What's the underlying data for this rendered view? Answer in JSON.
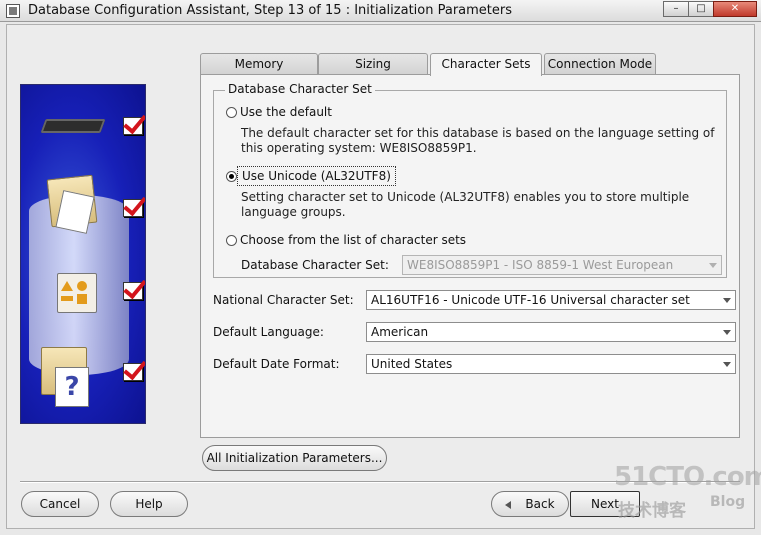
{
  "window": {
    "title": "Database Configuration Assistant, Step 13 of 15 : Initialization Parameters",
    "controls": [
      "–",
      "□",
      "✕"
    ]
  },
  "tabs": [
    {
      "label": "Memory",
      "active": false
    },
    {
      "label": "Sizing",
      "active": false
    },
    {
      "label": "Character Sets",
      "active": true
    },
    {
      "label": "Connection Mode",
      "active": false
    }
  ],
  "charset_group": {
    "legend": "Database Character Set",
    "use_default": {
      "label": "Use the default",
      "selected": false,
      "description": "The default character set for this database is based on the language setting of this operating system: WE8ISO8859P1."
    },
    "use_unicode": {
      "label": "Use Unicode (AL32UTF8)",
      "selected": true,
      "description": "Setting character set to Unicode (AL32UTF8) enables you to store multiple language groups."
    },
    "choose_list": {
      "label": "Choose from the list of character sets",
      "selected": false
    },
    "db_charset_label": "Database Character Set:",
    "db_charset_value": "WE8ISO8859P1 - ISO 8859-1 West European"
  },
  "fields": {
    "national_charset_label": "National Character Set:",
    "national_charset_value": "AL16UTF16 - Unicode UTF-16 Universal character set",
    "default_language_label": "Default Language:",
    "default_language_value": "American",
    "date_format_label": "Default Date Format:",
    "date_format_value": "United States"
  },
  "buttons": {
    "all_params": "All Initialization Parameters...",
    "cancel": "Cancel",
    "help": "Help",
    "back": "Back",
    "next": "Next"
  },
  "watermark": {
    "site": "51CTO.com",
    "tagline": "技术博客",
    "blog": "Blog"
  }
}
